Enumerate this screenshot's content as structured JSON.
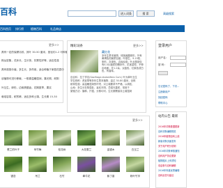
{
  "header": {
    "logo": "百科",
    "search_button_1": "进入词条",
    "search_button_2": "搜 索",
    "advanced_search": "高级搜索"
  },
  "nav": {
    "items": [
      "百科首页",
      "排行榜",
      "植物百科",
      "礼品商店"
    ]
  },
  "left_panel": {
    "more": "更多>>",
    "rows": [
      "具有一定的保健功效，其叶 30-50 厘米，茎径约1-2 可种植",
      "株丛密集，花序长，生长快，抗寒性好等，适应性强",
      "具有观赏价值，多生长，多药用，适合种植于家庭花园中",
      "该植物可进行移栽，一般喜温暖湿润，喜光照，耐阴",
      "叶互生，卵形，边缘具锯齿，花期夏季，果实",
      "栽培容易，耐贫瘠，适应多种土壤，生长期 15-30"
    ]
  },
  "center_panel": {
    "title": "精彩词条",
    "more": "更多>>",
    "plant_name": "藏红花",
    "desc": "多年生草本植物，球茎扁圆球形，外有黄褐色的膜质包被。叶基生，9-15枚，条形，灰绿色，边缘反卷；叶丛基部包有4-5片膜质的鞘状叶。花茎甚短，不伸出地面；花1-2朵，淡蓝色、红紫色或白色，有香味。",
    "lines": [
      "百合科：拉丁学名(Saxifraga stolonifera Curt.) 叶为单叶互生",
      "学名别称：虎耳草等多年生草本植物，高达 30-80 厘米，全株",
      "耐寒性强：喜温暖湿润的环境，对土壤要求不严格，以疏松、",
      "山地：多生长在阴湿处，喜欢半阴、忌强光直射，常用于",
      "繁殖方法：播种、扦插、分株均可，生长期需保持土壤湿润"
    ]
  },
  "login_panel": {
    "title": "登录用户",
    "user_label": "用户名：",
    "pass_label": "密 码：",
    "links": [
      "忘记密码了，下次...",
      "注册新用户",
      "找回密码",
      "帮助中心"
    ]
  },
  "news_panel": {
    "title": "站内公告  最新",
    "items": [
      "2016年词条数据更新",
      "百科词条编辑规范",
      "2016年植物百科上线",
      "新版词条页面发布",
      "关于用户积分说明",
      "2016年词条审核通知",
      "百科用户协议更新",
      "植物图片上传须知",
      "欢迎参与百科编辑",
      "2016年年度优秀编辑",
      "百科反馈与建议"
    ]
  },
  "grid": {
    "more": "更多>>",
    "captions_row1": [
      "葱兰的叶子",
      "吊竹梅",
      "桂花树",
      "大花蕙兰",
      "金银木",
      "白玉兰"
    ],
    "captions_row2": [
      "银杏",
      "吊兰",
      "石竹",
      "牵牛花",
      "紫丁香",
      "粉叶竹芋"
    ]
  }
}
